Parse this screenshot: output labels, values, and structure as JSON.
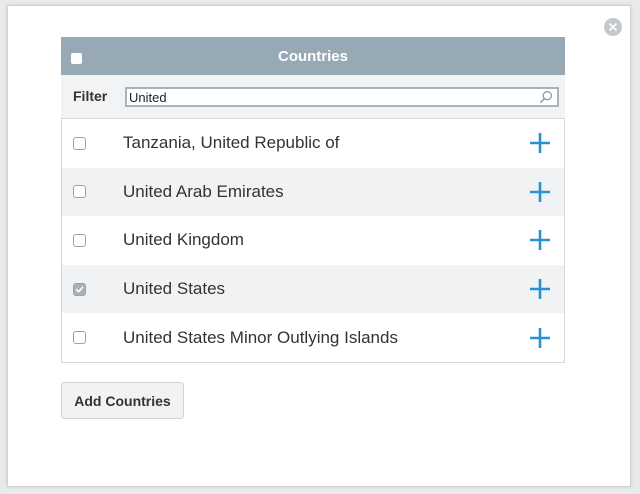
{
  "dialog": {
    "close_icon": "close-icon"
  },
  "panel": {
    "title": "Countries",
    "header_checkbox_checked": false
  },
  "filter": {
    "label": "Filter",
    "value": "United",
    "icon": "search-icon"
  },
  "countries": [
    {
      "name": "Tanzania, United Republic of",
      "checked": false
    },
    {
      "name": "United Arab Emirates",
      "checked": false
    },
    {
      "name": "United Kingdom",
      "checked": false
    },
    {
      "name": "United States",
      "checked": true
    },
    {
      "name": "United States Minor Outlying Islands",
      "checked": false
    }
  ],
  "row_action_icon": "plus-icon",
  "actions": {
    "add_label": "Add Countries"
  },
  "colors": {
    "header_bg": "#98a9b6",
    "accent_plus": "#2b8fd6",
    "row_alt_bg": "#f1f2f4"
  }
}
